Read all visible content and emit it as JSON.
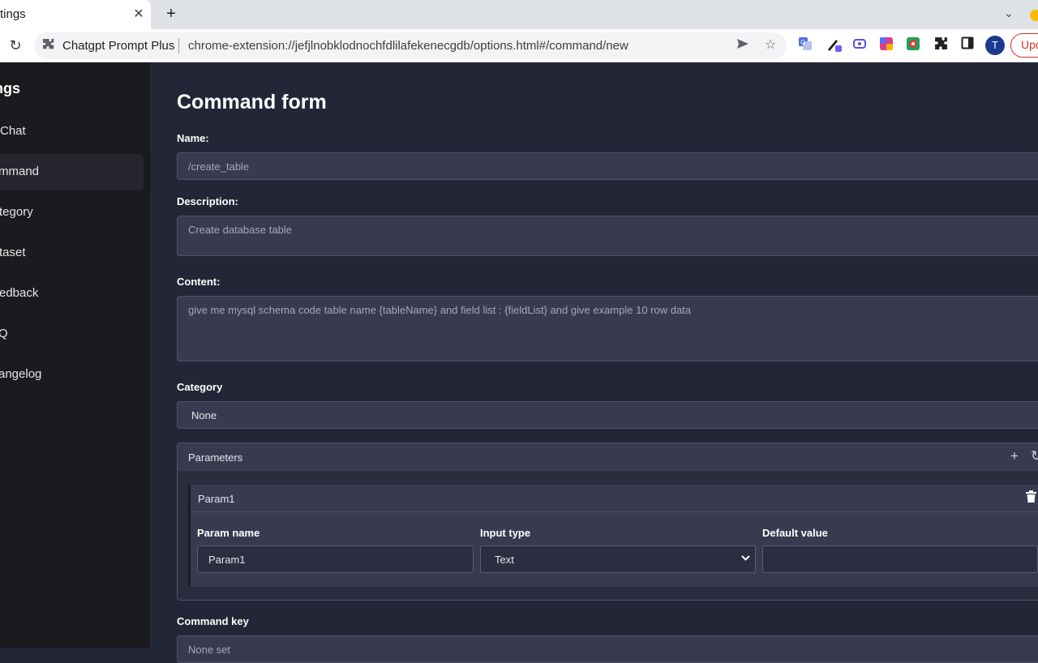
{
  "browser": {
    "tab_title": "tings",
    "tab_close": "✕",
    "new_tab": "+",
    "site_name": "Chatgpt Prompt Plus",
    "url": "chrome-extension://jefjlnobklodnochfdlilafekenecgdb/options.html#/command/new",
    "avatar_letter": "T",
    "update_label": "Upd"
  },
  "sidebar": {
    "heading": "ings",
    "items": [
      {
        "label": "Chat",
        "active": false
      },
      {
        "label": "mmand",
        "active": true
      },
      {
        "label": "tegory",
        "active": false
      },
      {
        "label": "taset",
        "active": false
      },
      {
        "label": "edback",
        "active": false
      },
      {
        "label": "Q",
        "active": false
      },
      {
        "label": "angelog",
        "active": false
      }
    ]
  },
  "form": {
    "title": "Command form",
    "name_label": "Name:",
    "name_placeholder": "/create_table",
    "description_label": "Description:",
    "description_placeholder": "Create database table",
    "content_label": "Content:",
    "content_value": "give me mysql schema code table name {tableName} and field list : {fieldList} and give example 10 row data",
    "category_label": "Category",
    "category_value": "None",
    "parameters_title": "Parameters",
    "param": {
      "title": "Param1",
      "name_label": "Param name",
      "name_value": "Param1",
      "type_label": "Input type",
      "type_value": "Text",
      "default_label": "Default value",
      "default_value": ""
    },
    "command_key_label": "Command key",
    "command_key_placeholder": "None set"
  },
  "colors": {
    "background": "#222636",
    "sidebar": "#1b1b1f",
    "field": "#383b50",
    "accent_update": "#d93025"
  },
  "icons": [
    "reload-icon",
    "puzzle-icon",
    "send-icon",
    "star-icon",
    "translate-icon",
    "pen-icon",
    "screen-icon",
    "gradient-icon",
    "record-icon",
    "extensions-icon",
    "sidepanel-icon",
    "plus-icon",
    "refresh-icon",
    "trash-icon",
    "chevron-down-icon"
  ]
}
